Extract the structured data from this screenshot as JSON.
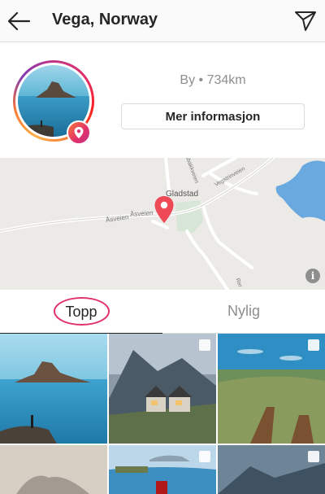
{
  "header": {
    "title": "Vega, Norway",
    "back_icon": "arrow-left-icon",
    "share_icon": "paper-plane-icon"
  },
  "profile": {
    "meta": "By • 734km",
    "more_button": "Mer informasjon",
    "badge_icon": "location-pin-icon"
  },
  "map": {
    "labels": {
      "gladstad": "Gladstad",
      "asveien_1": "Åsveien",
      "asveien_2": "Åsveien",
      "vegstrinveien": "Vegstrinveien",
      "risbakkveien": "Risbakkveien",
      "rer": "Rer"
    },
    "info_label": "i",
    "pin_icon": "map-pin-icon"
  },
  "tabs": [
    {
      "label": "Topp",
      "active": true
    },
    {
      "label": "Nylig",
      "active": false
    }
  ],
  "colors": {
    "accent_pink": "#e1306c",
    "pin_red": "#ed4956",
    "text_primary": "#262626",
    "text_secondary": "#8e8e8e"
  }
}
